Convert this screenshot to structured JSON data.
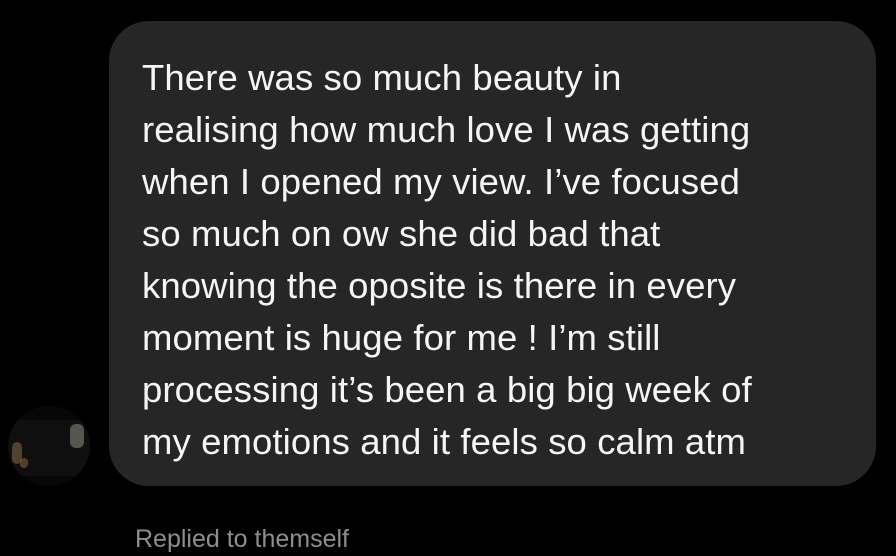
{
  "message": {
    "text": "There was so much beauty in\nrealising how much love I was getting\nwhen I opened my view. I’ve focused\nso much on ow she did bad that\nknowing the oposite is there in every\nmoment is huge for me ! I’m still\nprocessing it’s been a big big week of\nmy emotions and it feels so calm atm"
  },
  "reply_context": {
    "label": "Replied to themself"
  },
  "colors": {
    "background": "#000000",
    "bubble": "#262626",
    "message_text": "#f5f5f5",
    "meta_text": "#8e8e8e"
  }
}
